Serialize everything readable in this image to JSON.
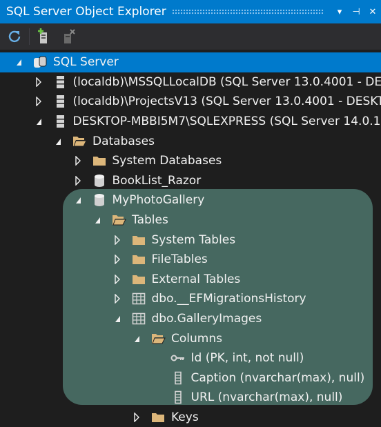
{
  "window": {
    "title": "SQL Server Object Explorer",
    "controls": [
      "▾",
      "⊣",
      "✕"
    ]
  },
  "toolbar": {
    "buttons": [
      {
        "name": "refresh",
        "icon": "refresh-icon"
      },
      {
        "name": "add-sql-server",
        "icon": "add-server-icon"
      },
      {
        "name": "disconnect",
        "icon": "disconnect-icon"
      }
    ]
  },
  "colors": {
    "accent": "#007acc",
    "selection": "#007acc",
    "highlight": "#466860",
    "background": "#1e1e1e",
    "folder": "#dcb67a"
  },
  "tree": [
    {
      "label": "SQL Server",
      "level": 0,
      "state": "expanded",
      "icon": "sql-server-icon",
      "selected": true
    },
    {
      "label": "(localdb)\\MSSQLLocalDB (SQL Server 13.0.4001 - DE",
      "level": 1,
      "state": "collapsed",
      "icon": "server-icon"
    },
    {
      "label": "(localdb)\\ProjectsV13 (SQL Server 13.0.4001 - DESKT",
      "level": 1,
      "state": "collapsed",
      "icon": "server-icon"
    },
    {
      "label": "DESKTOP-MBBI5M7\\SQLEXPRESS (SQL Server 14.0.1",
      "level": 1,
      "state": "expanded",
      "icon": "server-icon"
    },
    {
      "label": "Databases",
      "level": 2,
      "state": "expanded",
      "icon": "folder-open-icon"
    },
    {
      "label": "System Databases",
      "level": 3,
      "state": "collapsed",
      "icon": "folder-icon"
    },
    {
      "label": "BookList_Razor",
      "level": 3,
      "state": "collapsed",
      "icon": "database-icon"
    },
    {
      "label": "MyPhotoGallery",
      "level": 3,
      "state": "expanded",
      "icon": "database-icon"
    },
    {
      "label": "Tables",
      "level": 4,
      "state": "expanded",
      "icon": "folder-open-icon"
    },
    {
      "label": "System Tables",
      "level": 5,
      "state": "collapsed",
      "icon": "folder-icon"
    },
    {
      "label": "FileTables",
      "level": 5,
      "state": "collapsed",
      "icon": "folder-icon"
    },
    {
      "label": "External Tables",
      "level": 5,
      "state": "collapsed",
      "icon": "folder-icon"
    },
    {
      "label": "dbo.__EFMigrationsHistory",
      "level": 5,
      "state": "collapsed",
      "icon": "table-icon"
    },
    {
      "label": "dbo.GalleryImages",
      "level": 5,
      "state": "expanded",
      "icon": "table-icon"
    },
    {
      "label": "Columns",
      "level": 6,
      "state": "expanded",
      "icon": "folder-open-icon"
    },
    {
      "label": "Id (PK, int, not null)",
      "level": 7,
      "state": "leaf",
      "icon": "key-icon"
    },
    {
      "label": "Caption (nvarchar(max), null)",
      "level": 7,
      "state": "leaf",
      "icon": "column-icon"
    },
    {
      "label": "URL (nvarchar(max), null)",
      "level": 7,
      "state": "leaf",
      "icon": "column-icon"
    },
    {
      "label": "Keys",
      "level": 6,
      "state": "collapsed",
      "icon": "folder-icon"
    }
  ]
}
